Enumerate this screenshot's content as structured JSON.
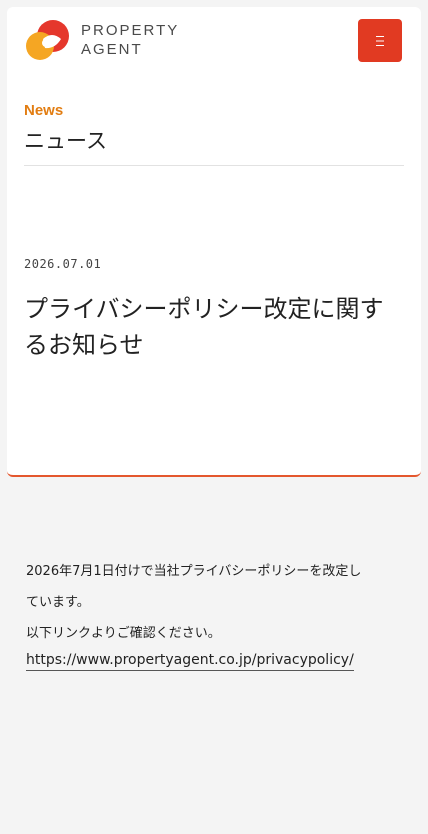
{
  "header": {
    "logo_line1": "PROPERTY",
    "logo_line2": "AGENT",
    "menu_icon": "hamburger-icon"
  },
  "section": {
    "label_en": "News",
    "label_jp": "ニュース"
  },
  "article": {
    "date": "2026.07.01",
    "title": "プライバシーポリシー改定に関するお知らせ",
    "body_line1": "2026年7月1日付けで当社プライバシーポリシーを改定し",
    "body_line2": "ています。",
    "body_line3": "以下リンクよりご確認ください。",
    "link": "https://www.propertyagent.co.jp/privacypolicy/"
  },
  "colors": {
    "accent_orange": "#e27d12",
    "menu_red": "#e13a22",
    "card_border": "#e4572e",
    "background": "#f4f4f4"
  }
}
